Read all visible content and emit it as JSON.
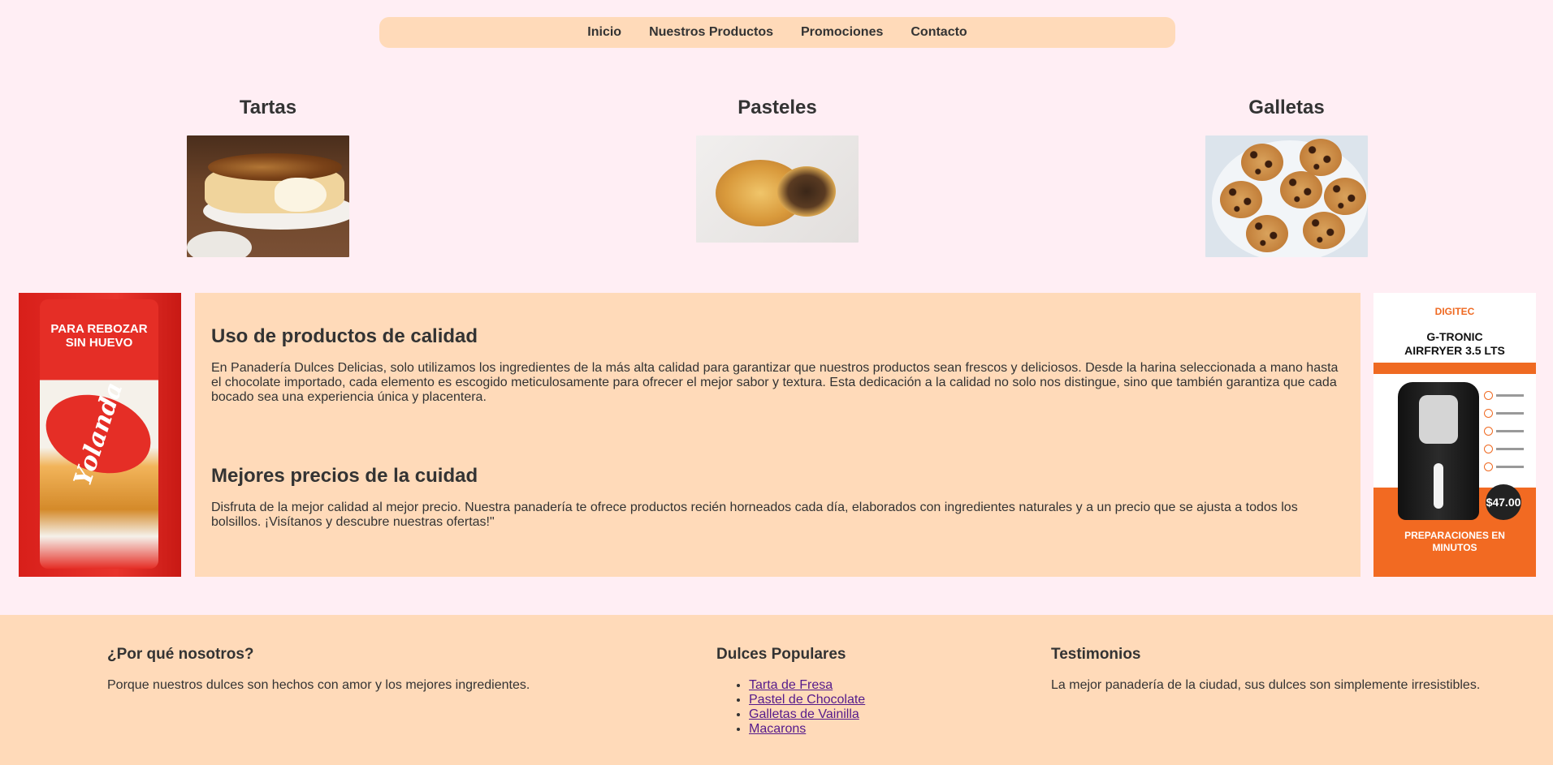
{
  "nav": {
    "items": [
      {
        "label": "Inicio"
      },
      {
        "label": "Nuestros Productos"
      },
      {
        "label": "Promociones"
      },
      {
        "label": "Contacto"
      }
    ]
  },
  "categories": [
    {
      "title": "Tartas",
      "image": "cheesecake-photo"
    },
    {
      "title": "Pasteles",
      "image": "pastries-photo"
    },
    {
      "title": "Galletas",
      "image": "chocolate-chip-cookies-photo"
    }
  ],
  "ads": {
    "left": {
      "image": "yolanda-flour-ad",
      "text_lines": [
        "PARA REBOZAR",
        "SIN HUEVO"
      ],
      "brand": "Yolanda"
    },
    "right": {
      "image": "airfryer-ad",
      "brand": "DIGITEC",
      "title_lines": [
        "G-TRONIC",
        "AIRFRYER 3.5 LTS"
      ],
      "price": "$47.00",
      "footer_lines": [
        "PREPARACIONES EN",
        "MINUTOS"
      ]
    }
  },
  "info": {
    "section1_title": "Uso de productos de calidad",
    "section1_text": "En Panadería Dulces Delicias, solo utilizamos los ingredientes de la más alta calidad para garantizar que nuestros productos sean frescos y deliciosos. Desde la harina seleccionada a mano hasta el chocolate importado, cada elemento es escogido meticulosamente para ofrecer el mejor sabor y textura. Esta dedicación a la calidad no solo nos distingue, sino que también garantiza que cada bocado sea una experiencia única y placentera.",
    "section2_title": "Mejores precios de la cuidad",
    "section2_text": "Disfruta de la mejor calidad al mejor precio. Nuestra panadería te ofrece productos recién horneados cada día, elaborados con ingredientes naturales y a un precio que se ajusta a todos los bolsillos. ¡Visítanos y descubre nuestras ofertas!\""
  },
  "footer": {
    "why_title": "¿Por qué nosotros?",
    "why_text": "Porque nuestros dulces son hechos con amor y los mejores ingredientes.",
    "popular_title": "Dulces Populares",
    "popular_items": [
      "Tarta de Fresa",
      "Pastel de Chocolate",
      "Galletas de Vainilla",
      "Macarons"
    ],
    "testimonials_title": "Testimonios",
    "testimonials_text": "La mejor panadería de la ciudad, sus dulces son simplemente irresistibles."
  },
  "colors": {
    "background": "#ffeef4",
    "accent": "#ffdab9",
    "link_visited": "#551a8b"
  }
}
